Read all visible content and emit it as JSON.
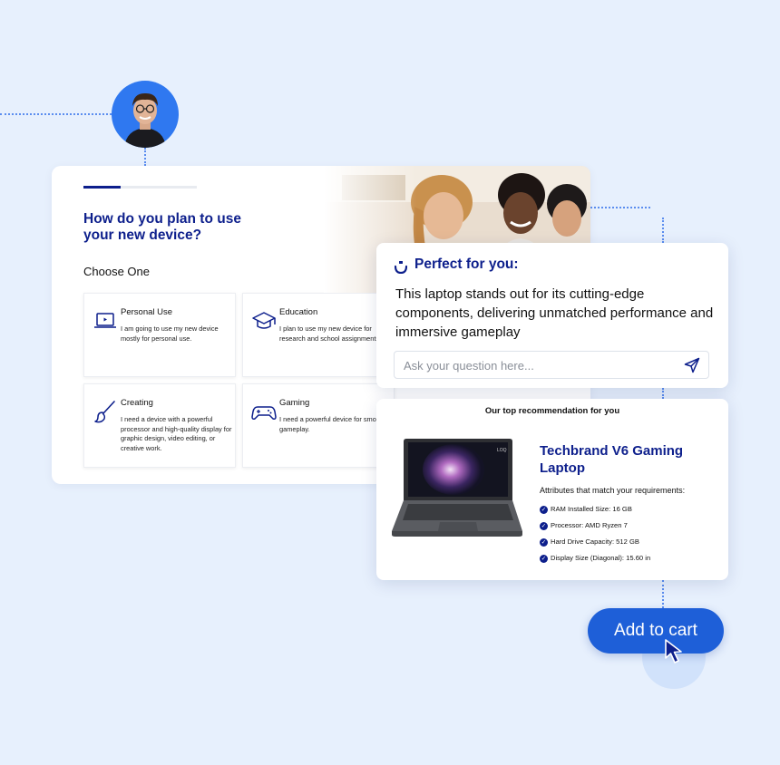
{
  "quiz": {
    "progress": 0.33,
    "title": "How do you plan to use your new device?",
    "choose_label": "Choose One",
    "options": [
      {
        "icon": "laptop-icon",
        "title": "Personal Use",
        "desc": "I am going to use my new device mostly for personal use."
      },
      {
        "icon": "graduation-cap-icon",
        "title": "Education",
        "desc": "I plan to use my new device for research and school assignments."
      },
      {
        "icon": "paintbrush-icon",
        "title": "Creating",
        "desc": "I need a device with a powerful processor and high-quality display for graphic design, video editing, or creative work."
      },
      {
        "icon": "gamepad-icon",
        "title": "Gaming",
        "desc": "I need a powerful device for smooth gameplay."
      }
    ]
  },
  "chat": {
    "heading": "Perfect for you:",
    "message": "This laptop stands out for its cutting-edge components, delivering unmatched performance and immersive gameplay",
    "input_placeholder": "Ask your question here...",
    "send_icon": "send-icon"
  },
  "recommendation": {
    "heading": "Our top recommendation for you",
    "product_name": "Techbrand V6 Gaming Laptop",
    "attributes_heading": "Attributes that match your requirements:",
    "attributes": [
      "RAM Installed Size: 16 GB",
      "Processor: AMD Ryzen 7",
      "Hard Drive Capacity: 512 GB",
      "Display Size (Diagonal): 15.60 in"
    ],
    "laptop_brand": "LOQ"
  },
  "cart": {
    "label": "Add to cart"
  },
  "colors": {
    "accent": "#0d1f8c",
    "button": "#1e5fd8",
    "background": "#e7f0fd"
  }
}
